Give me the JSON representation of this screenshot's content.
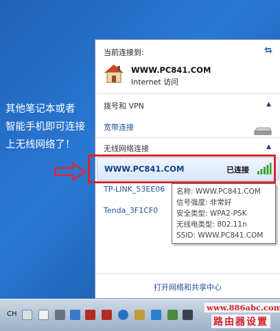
{
  "annotation": {
    "lines": [
      "其他笔记本或者",
      "智能手机即可连接",
      "上无线网络了！"
    ]
  },
  "panel": {
    "current_label": "当前连接到:",
    "current_name": "WWW.PC841.COM",
    "current_status": "Internet 访问",
    "dialup_label": "拨号和 VPN",
    "broadband_label": "宽带连接",
    "wireless_label": "无线网络连接",
    "selected_network": "WWW.PC841.COM",
    "selected_status": "已连接",
    "networks": [
      "TP-LINK_53EE06",
      "Tenda_3F1CF0"
    ],
    "footer_link": "打开网络和共享中心"
  },
  "tooltip": {
    "lines": [
      "名称: WWW.PC841.COM",
      "信号强度: 非常好",
      "安全类型: WPA2-PSK",
      "无线电类型: 802.11n",
      "SSID: WWW.PC841.COM"
    ]
  },
  "taskbar": {
    "language": "CH"
  },
  "watermark": {
    "url": "www.886abc.com",
    "text": "路由器设置"
  },
  "colors": {
    "desktop": "#1e62b8",
    "link": "#1c4f9c",
    "highlight": "#d7262e",
    "signal": "#3aa52f"
  }
}
